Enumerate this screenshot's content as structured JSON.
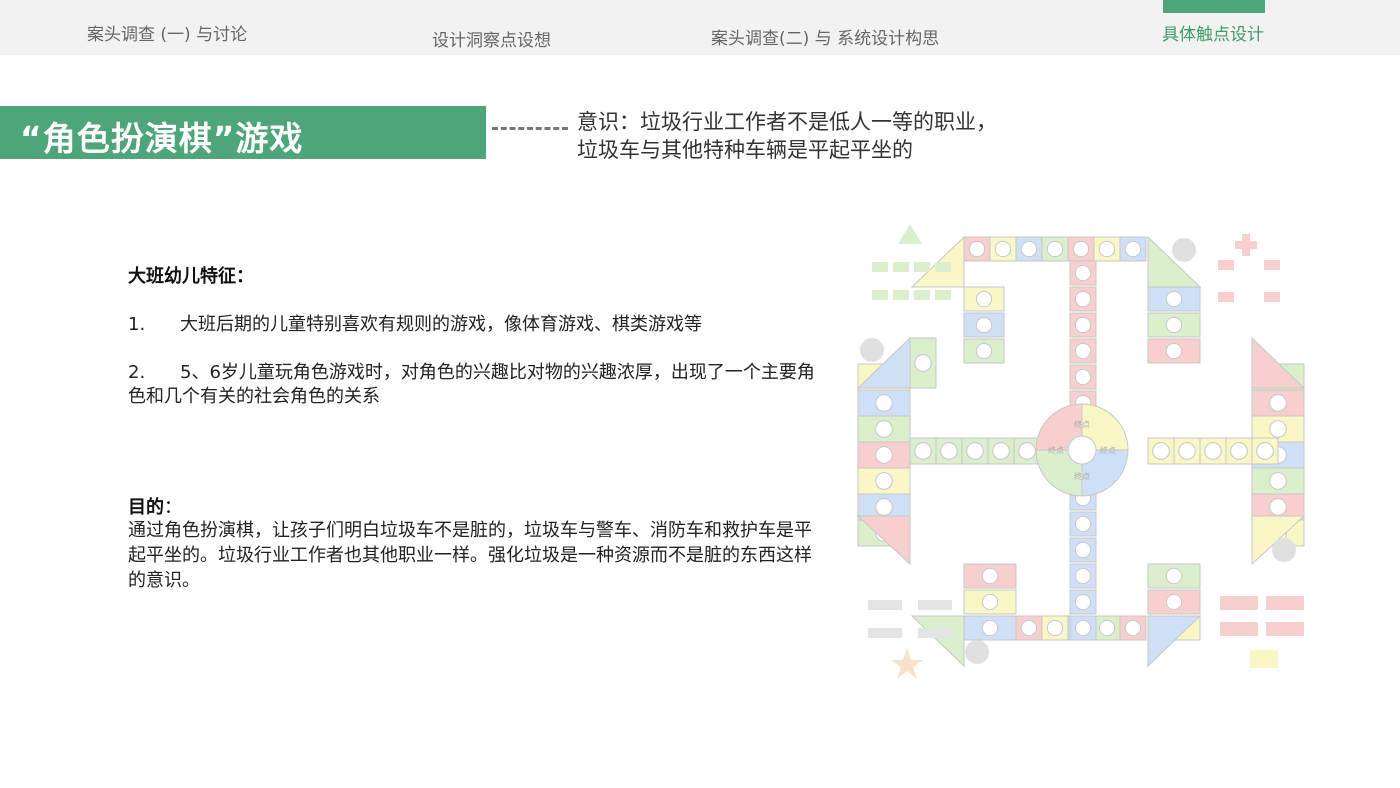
{
  "nav": {
    "items": [
      {
        "label": "案头调查 (一) 与讨论"
      },
      {
        "label": "设计洞察点设想"
      },
      {
        "label": "案头调查(二) 与 系统设计构思"
      },
      {
        "label": "具体触点设计"
      }
    ],
    "active_index": 3,
    "accent_color": "#4fa57a"
  },
  "title": {
    "text": "“角色扮演棋”游戏",
    "awareness_line1": "意识：垃圾行业工作者不是低人一等的职业，",
    "awareness_line2": "垃圾车与其他特种车辆是平起平坐的"
  },
  "features": {
    "heading": "大班幼儿特征：",
    "items": [
      {
        "num": "1.",
        "text": "大班后期的儿童特别喜欢有规则的游戏，像体育游戏、棋类游戏等"
      },
      {
        "num": "2.",
        "text": "5、6岁儿童玩角色游戏时，对角色的兴趣比对物的兴趣浓厚，出现了一个主要角色和几个有关的社会角色的关系"
      }
    ]
  },
  "goal": {
    "heading": "目的",
    "colon": "：",
    "text": "通过角色扮演棋，让孩子们明白垃圾车不是脏的，垃圾车与警车、消防车和救护车是平起平坐的。垃圾行业工作者也其他职业一样。强化垃圾是一种资源而不是脏的东西这样的意识。"
  },
  "board": {
    "center_label": "终点",
    "colors": {
      "red": "#f4a9a9",
      "yellow": "#f7f29a",
      "blue": "#a9c6ee",
      "green": "#bfe3a6",
      "border": "#9a9a9a"
    },
    "icons": [
      "garbage-truck-icon",
      "police-car-icon",
      "fire-truck-icon",
      "ambulance-icon",
      "star-icon",
      "cross-icon",
      "recycle-icon",
      "arrow-icon"
    ]
  }
}
